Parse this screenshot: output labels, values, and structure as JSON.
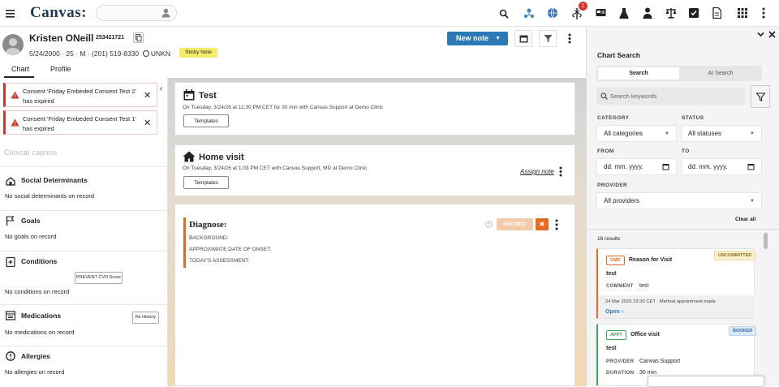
{
  "app": {
    "logo": "Canvas:",
    "notification_count": "1"
  },
  "topbar_icons": [
    "menu-icon",
    "user-search-icon",
    "search-icon",
    "user-network-icon",
    "globe-icon",
    "caduceus-icon",
    "id-card-icon",
    "lab-flask-icon",
    "person-icon",
    "scale-icon",
    "checkbox-icon",
    "document-icon",
    "grid-icon",
    "more-vertical-icon"
  ],
  "patient": {
    "name": "Kristen ONeill",
    "mrn": "253421721",
    "demographics": "5/24/2000 · 25 · M · (201) 519-8330",
    "timezone": "UNKN",
    "sticky_note": "Sticky Note"
  },
  "toolbar": {
    "new_note": "New note"
  },
  "tabs": [
    {
      "label": "Chart",
      "active": true
    },
    {
      "label": "Profile",
      "active": false
    }
  ],
  "alerts": [
    {
      "text": "Consent 'Friday Embeded Consent Test 2' has expired"
    },
    {
      "text": "Consent 'Friday Embeded Consent Test 1' has expired"
    }
  ],
  "clinical_caption": "Clinical caption",
  "sections": [
    {
      "title": "Social Determinants",
      "empty": "No social determinants on record",
      "icon": "social-icon"
    },
    {
      "title": "Goals",
      "empty": "No goals on record",
      "icon": "flag-icon"
    },
    {
      "title": "Conditions",
      "empty": "No conditions on record",
      "icon": "conditions-icon",
      "button": "PREVENT CVD Score"
    },
    {
      "title": "Medications",
      "empty": "No medications on record",
      "icon": "medication-icon",
      "button": "Rx History"
    },
    {
      "title": "Allergies",
      "empty": "No allergies on record",
      "icon": "allergy-icon"
    }
  ],
  "notes": [
    {
      "title": "Test",
      "subtitle": "On Tuesday, 3/24/26 at 11:30 PM CET for 30 min with Canvas Support at Demo Clinic",
      "button": "Templates",
      "icon": "calendar-icon"
    },
    {
      "title": "Home visit",
      "subtitle": "On Tuesday, 3/24/26 at 1:03 PM CET with Canvas Support, MD at Demo Clinic",
      "button": "Templates",
      "assign": "Assign note",
      "icon": "home-icon"
    }
  ],
  "diagnose": {
    "title": "Diagnose:",
    "fields": [
      "BACKGROUND:",
      "APPROXIMATE DATE OF ONSET:",
      "TODAY'S ASSESSMENT:"
    ],
    "record": "RECORD",
    "cancel": "✖"
  },
  "chart_search": {
    "title": "Chart Search",
    "tab_search": "Search",
    "tab_ai": "AI Search",
    "keywords_placeholder": "Search keywords",
    "category_label": "CATEGORY",
    "category_value": "All categories",
    "status_label": "STATUS",
    "status_value": "All statuses",
    "from_label": "FROM",
    "from_value": "dd. mm. yyyy.",
    "to_label": "TO",
    "to_value": "dd. mm. yyyy.",
    "provider_label": "PROVIDER",
    "provider_value": "All providers",
    "clear_all": "Clear all",
    "results_count": "16 results",
    "results": [
      {
        "type": "CMD",
        "title": "Reason for Visit",
        "status": "UNCOMMITTED",
        "body": "test",
        "field1_label": "COMMENT",
        "field1_value": "test",
        "meta": "24 Mar 2026 23:30 CET · Method appointment made",
        "link": "Open",
        "accent": "#e86a1e"
      },
      {
        "type": "APPT",
        "title": "Office visit",
        "status": "BOOKED",
        "body": "test",
        "field1_label": "PROVIDER",
        "field1_value": "Canvas Support",
        "field2_label": "DURATION",
        "field2_value": "30 min",
        "accent": "#3aa655"
      }
    ]
  },
  "colors": {
    "primary": "#2a7ab8",
    "danger": "#d9342b",
    "accent": "#e86a1e",
    "sticky": "#f7ec6a"
  }
}
